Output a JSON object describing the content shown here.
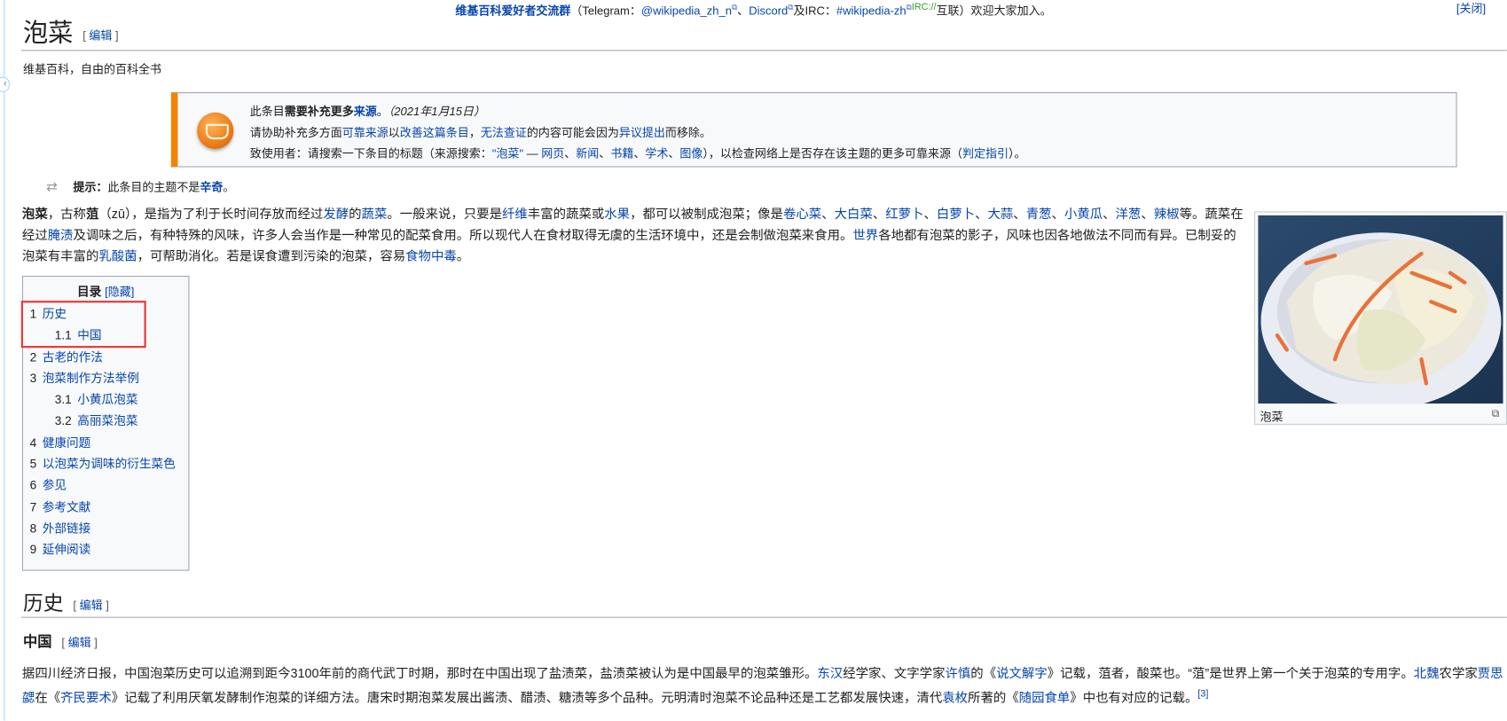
{
  "notice": {
    "segments": [
      {
        "t": "维基百科爱好者交流群",
        "link": true,
        "bold": true
      },
      {
        "t": "（Telegram："
      },
      {
        "t": "@wikipedia_zh_n",
        "link": true,
        "ext": true
      },
      {
        "t": "、"
      },
      {
        "t": "Discord",
        "link": true,
        "ext": true
      },
      {
        "t": "及IRC："
      },
      {
        "t": "#wikipedia-zh",
        "link": true,
        "ext": true
      },
      {
        "t": "IRC://",
        "irc": true
      },
      {
        "t": "互联）欢迎大家加入。"
      }
    ],
    "close_label": "[关闭]"
  },
  "page": {
    "title": "泡菜",
    "edit_label": "编辑",
    "tagline": "维基百科，自由的百科全书"
  },
  "ambox": {
    "icon": "book-question-icon",
    "accent": "#f28500",
    "lines": [
      [
        {
          "t": "此条目"
        },
        {
          "t": "需要补充更多",
          "bold": true
        },
        {
          "t": "来源",
          "link": true,
          "bold": true
        },
        {
          "t": "。"
        },
        {
          "t": "（2021年1月15日）",
          "italic": true
        }
      ],
      [
        {
          "t": "请协助补充多方面"
        },
        {
          "t": "可靠来源",
          "link": true
        },
        {
          "t": "以"
        },
        {
          "t": "改善这篇条目",
          "link": true
        },
        {
          "t": "，"
        },
        {
          "t": "无法查证",
          "link": true
        },
        {
          "t": "的内容可能会因为"
        },
        {
          "t": "异议提出",
          "link": true
        },
        {
          "t": "而移除。"
        }
      ],
      [
        {
          "t": "致使用者：请搜索一下条目的标题（来源搜索："
        },
        {
          "t": "\"泡菜\"",
          "link": true
        },
        {
          "t": " — "
        },
        {
          "t": "网页",
          "link": true
        },
        {
          "t": "、"
        },
        {
          "t": "新闻",
          "link": true
        },
        {
          "t": "、"
        },
        {
          "t": "书籍",
          "link": true
        },
        {
          "t": "、"
        },
        {
          "t": "学术",
          "link": true
        },
        {
          "t": "、"
        },
        {
          "t": "图像",
          "link": true
        },
        {
          "t": "），以检查网络上是否存在该主题的更多可靠来源（"
        },
        {
          "t": "判定指引",
          "link": true
        },
        {
          "t": "）。"
        }
      ]
    ]
  },
  "hatnote": [
    {
      "t": "提示：",
      "bold": true
    },
    {
      "t": "此条目的主题不是"
    },
    {
      "t": "辛奇",
      "link": true,
      "bold": true
    },
    {
      "t": "。"
    }
  ],
  "intro": [
    {
      "t": "泡菜",
      "bold": true
    },
    {
      "t": "，古称"
    },
    {
      "t": "菹",
      "bold": true
    },
    {
      "t": "（zū），是指为了利于长时间存放而经过"
    },
    {
      "t": "发酵",
      "link": true
    },
    {
      "t": "的"
    },
    {
      "t": "蔬菜",
      "link": true
    },
    {
      "t": "。一般来说，只要是"
    },
    {
      "t": "纤维",
      "link": true
    },
    {
      "t": "丰富的蔬菜或"
    },
    {
      "t": "水果",
      "link": true
    },
    {
      "t": "，都可以被制成泡菜；像是"
    },
    {
      "t": "卷心菜",
      "link": true
    },
    {
      "t": "、"
    },
    {
      "t": "大白菜",
      "link": true
    },
    {
      "t": "、"
    },
    {
      "t": "红萝卜",
      "link": true
    },
    {
      "t": "、"
    },
    {
      "t": "白萝卜",
      "link": true
    },
    {
      "t": "、"
    },
    {
      "t": "大蒜",
      "link": true
    },
    {
      "t": "、"
    },
    {
      "t": "青葱",
      "link": true
    },
    {
      "t": "、"
    },
    {
      "t": "小黄瓜",
      "link": true
    },
    {
      "t": "、"
    },
    {
      "t": "洋葱",
      "link": true
    },
    {
      "t": "、"
    },
    {
      "t": "辣椒",
      "link": true
    },
    {
      "t": "等。蔬菜在经过"
    },
    {
      "t": "腌渍",
      "link": true
    },
    {
      "t": "及调味之后，有种特殊的风味，许多人会当作是一种常见的配菜食用。所以现代人在食材取得无虞的生活环境中，还是会制做泡菜来食用。"
    },
    {
      "t": "世界",
      "link": true
    },
    {
      "t": "各地都有泡菜的影子，风味也因各地做法不同而有异。已制妥的泡菜有丰富的"
    },
    {
      "t": "乳酸菌",
      "link": true
    },
    {
      "t": "，可帮助消化。若是误食遭到污染的泡菜，容易"
    },
    {
      "t": "食物中毒",
      "link": true
    },
    {
      "t": "。"
    }
  ],
  "infobox": {
    "caption": "泡菜",
    "enlarge_icon": "magnify-icon"
  },
  "toc": {
    "title": "目录",
    "hide_label": "[隐藏]",
    "items": [
      {
        "num": "1",
        "label": "历史",
        "level": 1
      },
      {
        "num": "1.1",
        "label": "中国",
        "level": 2
      },
      {
        "num": "2",
        "label": "古老的作法",
        "level": 1
      },
      {
        "num": "3",
        "label": "泡菜制作方法举例",
        "level": 1
      },
      {
        "num": "3.1",
        "label": "小黄瓜泡菜",
        "level": 2
      },
      {
        "num": "3.2",
        "label": "高丽菜泡菜",
        "level": 2
      },
      {
        "num": "4",
        "label": "健康问题",
        "level": 1
      },
      {
        "num": "5",
        "label": "以泡菜为调味的衍生菜色",
        "level": 1
      },
      {
        "num": "6",
        "label": "参见",
        "level": 1
      },
      {
        "num": "7",
        "label": "参考文献",
        "level": 1
      },
      {
        "num": "8",
        "label": "外部链接",
        "level": 1
      },
      {
        "num": "9",
        "label": "延伸阅读",
        "level": 1
      }
    ]
  },
  "history": {
    "heading": "历史",
    "sub_heading": "中国",
    "paragraph": [
      {
        "t": "据四川经济日报，中国泡菜历史可以追溯到距今3100年前的商代武丁时期，那时在中国出现了盐渍菜，盐渍菜被认为是中国最早的泡菜雏形。"
      },
      {
        "t": "东汉",
        "link": true
      },
      {
        "t": "经学家、文字学家"
      },
      {
        "t": "许慎",
        "link": true
      },
      {
        "t": "的《"
      },
      {
        "t": "说文解字",
        "link": true
      },
      {
        "t": "》记载，菹者，酸菜也。“菹”是世界上第一个关于泡菜的专用字。"
      },
      {
        "t": "北魏",
        "link": true
      },
      {
        "t": "农学家"
      },
      {
        "t": "贾思勰",
        "link": true
      },
      {
        "t": "在《"
      },
      {
        "t": "齐民要术",
        "link": true
      },
      {
        "t": "》记载了利用厌氧发酵制作泡菜的详细方法。唐宋时期泡菜发展出酱渍、醋渍、糖渍等多个品种。元明清时泡菜不论品种还是工艺都发展快速，清代"
      },
      {
        "t": "袁枚",
        "link": true
      },
      {
        "t": "所著的《"
      },
      {
        "t": "随园食单",
        "link": true
      },
      {
        "t": "》中也有对应的记载。"
      },
      {
        "t": "[3]",
        "link": true,
        "sup": true
      }
    ]
  }
}
